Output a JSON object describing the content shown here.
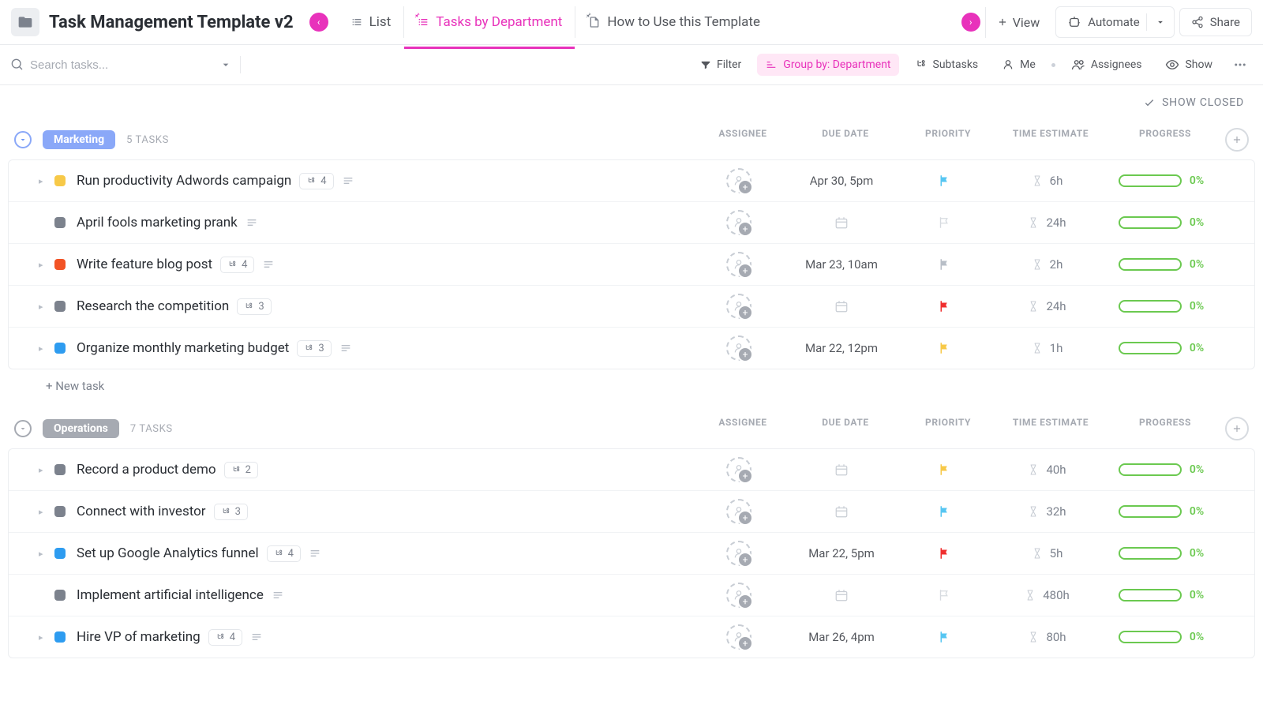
{
  "header": {
    "title": "Task Management Template v2",
    "views": [
      {
        "label": "List",
        "icon": "list",
        "active": false
      },
      {
        "label": "Tasks by Department",
        "icon": "list-pinned",
        "active": true
      },
      {
        "label": "How to Use this Template",
        "icon": "doc-pinned",
        "active": false
      }
    ],
    "add_view_label": "View",
    "automate_label": "Automate",
    "share_label": "Share"
  },
  "toolbar": {
    "search_placeholder": "Search tasks...",
    "filter_label": "Filter",
    "group_label": "Group by: Department",
    "subtasks_label": "Subtasks",
    "me_label": "Me",
    "assignees_label": "Assignees",
    "show_label": "Show"
  },
  "show_closed_label": "SHOW CLOSED",
  "columns": {
    "assignee": "ASSIGNEE",
    "due": "DUE DATE",
    "priority": "PRIORITY",
    "estimate": "TIME ESTIMATE",
    "progress": "PROGRESS"
  },
  "new_task_label": "+ New task",
  "colors": {
    "accent": "#e832bb",
    "marketing_chip": "#8aa8f8",
    "operations_chip": "#a6aab2",
    "progress_green": "#6bc950",
    "status_yellow": "#f7c948",
    "status_gray": "#7c828d",
    "status_orange": "#f25325",
    "status_blue": "#2e9cf0",
    "flag_blue": "#56c6f2",
    "flag_none": "#d7dbe0",
    "flag_gray": "#b8bec7",
    "flag_red": "#f02e2e",
    "flag_yellow": "#f7c948"
  },
  "groups": [
    {
      "name": "Marketing",
      "chip_color": "#8aa8f8",
      "collapse_color": "#6a95f7",
      "task_count_label": "5 TASKS",
      "tasks": [
        {
          "title": "Run productivity Adwords campaign",
          "status_color": "#f7c948",
          "caret": true,
          "subtasks": "4",
          "desc": true,
          "due": "Apr 30, 5pm",
          "priority_color": "#56c6f2",
          "estimate": "6h",
          "progress": "0%"
        },
        {
          "title": "April fools marketing prank",
          "status_color": "#7c828d",
          "caret": false,
          "subtasks": null,
          "desc": true,
          "due": null,
          "priority_color": "#d7dbe0",
          "estimate": "24h",
          "progress": "0%"
        },
        {
          "title": "Write feature blog post",
          "status_color": "#f25325",
          "caret": true,
          "subtasks": "4",
          "desc": true,
          "due": "Mar 23, 10am",
          "priority_color": "#b8bec7",
          "estimate": "2h",
          "progress": "0%"
        },
        {
          "title": "Research the competition",
          "status_color": "#7c828d",
          "caret": true,
          "subtasks": "3",
          "desc": false,
          "due": null,
          "priority_color": "#f02e2e",
          "estimate": "24h",
          "progress": "0%"
        },
        {
          "title": "Organize monthly marketing budget",
          "status_color": "#2e9cf0",
          "caret": true,
          "subtasks": "3",
          "desc": true,
          "due": "Mar 22, 12pm",
          "priority_color": "#f7c948",
          "estimate": "1h",
          "progress": "0%"
        }
      ]
    },
    {
      "name": "Operations",
      "chip_color": "#a6aab2",
      "collapse_color": "#a6aab2",
      "task_count_label": "7 TASKS",
      "tasks": [
        {
          "title": "Record a product demo",
          "status_color": "#7c828d",
          "caret": true,
          "subtasks": "2",
          "desc": false,
          "due": null,
          "priority_color": "#f7c948",
          "estimate": "40h",
          "progress": "0%"
        },
        {
          "title": "Connect with investor",
          "status_color": "#7c828d",
          "caret": true,
          "subtasks": "3",
          "desc": false,
          "due": null,
          "priority_color": "#56c6f2",
          "estimate": "32h",
          "progress": "0%"
        },
        {
          "title": "Set up Google Analytics funnel",
          "status_color": "#2e9cf0",
          "caret": true,
          "subtasks": "4",
          "desc": true,
          "due": "Mar 22, 5pm",
          "priority_color": "#f02e2e",
          "estimate": "5h",
          "progress": "0%"
        },
        {
          "title": "Implement artificial intelligence",
          "status_color": "#7c828d",
          "caret": false,
          "subtasks": null,
          "desc": true,
          "due": null,
          "priority_color": "#d7dbe0",
          "estimate": "480h",
          "progress": "0%"
        },
        {
          "title": "Hire VP of marketing",
          "status_color": "#2e9cf0",
          "caret": true,
          "subtasks": "4",
          "desc": true,
          "due": "Mar 26, 4pm",
          "priority_color": "#56c6f2",
          "estimate": "80h",
          "progress": "0%"
        }
      ]
    }
  ]
}
